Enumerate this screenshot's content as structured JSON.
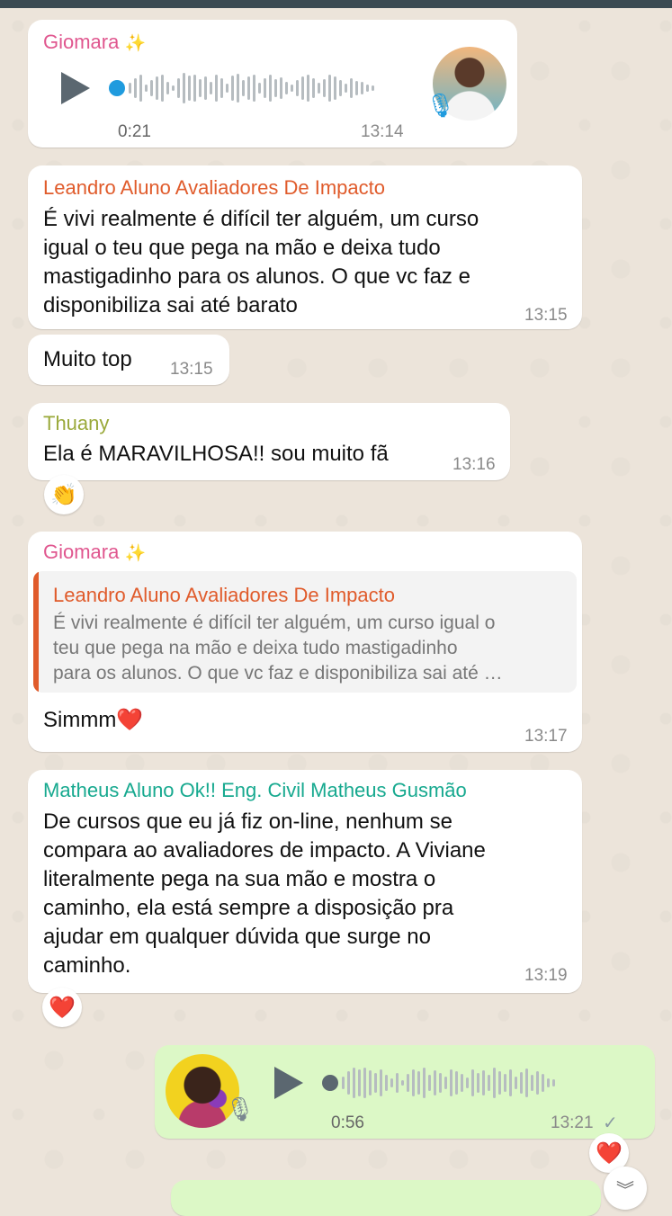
{
  "colors": {
    "giomara": "#e0578f",
    "leandro": "#e05b2b",
    "thuany": "#9aa93a",
    "matheus": "#17a98f",
    "accent_blue": "#1f9bde",
    "check": "#8a9aa3"
  },
  "messages": [
    {
      "type": "voice",
      "sender": "Giomara",
      "sparkle": "✨",
      "duration": "0:21",
      "time": "13:14",
      "avatar_icon": "user-photo",
      "mic_icon": "mic-icon"
    },
    {
      "type": "text",
      "sender": "Leandro Aluno Avaliadores De Impacto",
      "text": "É vivi realmente é difícil ter alguém, um curso\nigual o teu que pega na mão e deixa tudo\nmastigadinho para os alunos. O que vc faz e\ndisponibiliza sai até barato",
      "time": "13:15"
    },
    {
      "type": "text",
      "text": "Muito top",
      "time": "13:15"
    },
    {
      "type": "text",
      "sender": "Thuany",
      "text": "Ela é MARAVILHOSA!! sou muito fã",
      "time": "13:16",
      "reaction": "👏"
    },
    {
      "type": "reply",
      "sender": "Giomara",
      "sparkle": "✨",
      "quote_sender": "Leandro Aluno Avaliadores De Impacto",
      "quote_text": "É vivi realmente é difícil ter alguém, um curso igual o\nteu que pega na mão e deixa tudo mastigadinho\npara os alunos. O que vc faz e disponibiliza sai até …",
      "text": "Simmm❤️",
      "time": "13:17"
    },
    {
      "type": "text",
      "sender": "Matheus Aluno Ok!! Eng. Civil Matheus Gusmão",
      "text": "De cursos que eu já fiz on-line, nenhum se\ncompara ao avaliadores de impacto. A Viviane\nliteralmente pega na sua mão e mostra o\ncaminho, ela está sempre a disposição pra\najudar em qualquer dúvida que surge no\ncaminho.",
      "time": "13:19",
      "reaction": "❤️"
    },
    {
      "type": "voice_out",
      "duration": "0:56",
      "time": "13:21",
      "status": "✓",
      "reaction": "❤️"
    }
  ],
  "scroll_down_icon": "︾"
}
